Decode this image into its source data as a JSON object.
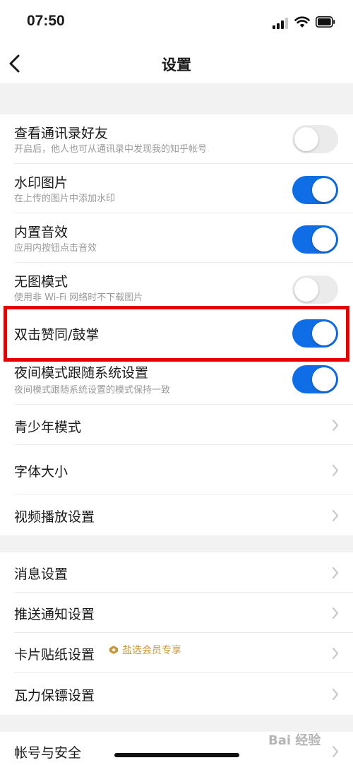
{
  "status": {
    "time": "07:50"
  },
  "nav": {
    "title": "设置"
  },
  "section1": {
    "rows": [
      {
        "title": "查看通讯录好友",
        "subtitle": "开启后，他人也可从通讯录中发现我的知乎帐号",
        "toggle": "off"
      },
      {
        "title": "水印图片",
        "subtitle": "在上传的图片中添加水印",
        "toggle": "on"
      },
      {
        "title": "内置音效",
        "subtitle": "应用内按钮点击音效",
        "toggle": "on"
      },
      {
        "title": "无图模式",
        "subtitle": "使用非 Wi-Fi 网络时不下载图片",
        "toggle": "off"
      },
      {
        "title": "双击赞同/鼓掌",
        "toggle": "on"
      },
      {
        "title": "夜间模式跟随系统设置",
        "subtitle": "夜间模式跟随系统设置的模式保持一致",
        "toggle": "on"
      },
      {
        "title": "青少年模式"
      },
      {
        "title": "字体大小"
      },
      {
        "title": "视频播放设置"
      }
    ]
  },
  "section2": {
    "rows": [
      {
        "title": "消息设置"
      },
      {
        "title": "推送通知设置"
      },
      {
        "title": "卡片贴纸设置",
        "badge": "盐选会员专享"
      },
      {
        "title": "瓦力保镖设置"
      }
    ]
  },
  "section3": {
    "rows": [
      {
        "title": "帐号与安全"
      }
    ]
  },
  "watermark": {
    "text": "Bai 经验"
  },
  "colors": {
    "accent": "#0f6ee6",
    "highlight": "#e60000",
    "badge": "#c9963a"
  }
}
